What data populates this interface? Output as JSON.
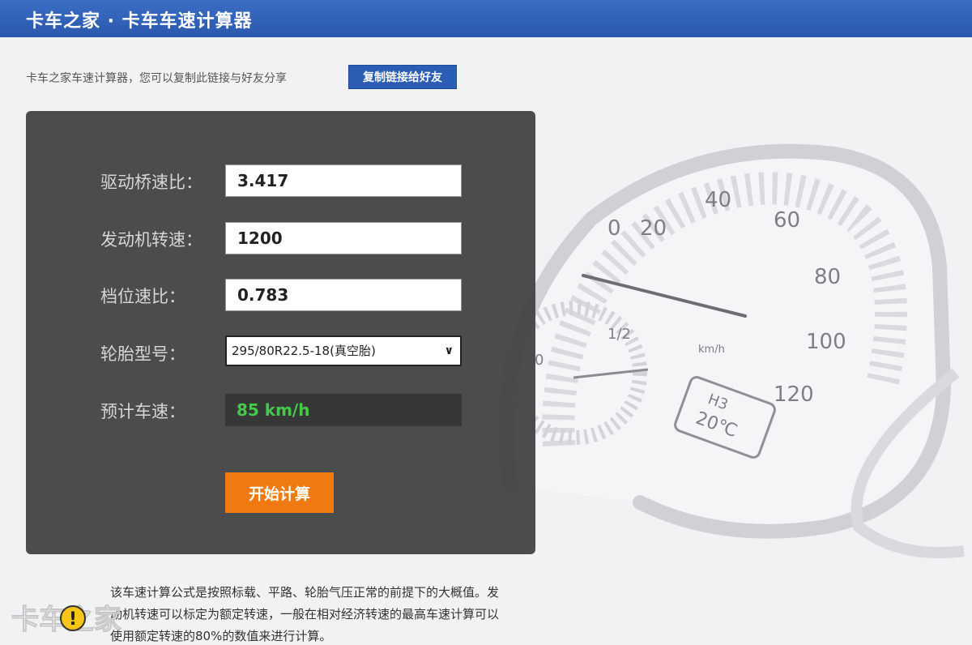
{
  "header": {
    "title": "卡车之家 · 卡车车速计算器"
  },
  "share": {
    "text": "卡车之家车速计算器，您可以复制此链接与好友分享",
    "button_label": "复制链接给好友"
  },
  "form": {
    "axle_ratio": {
      "label": "驱动桥速比：",
      "value": "3.417"
    },
    "engine_speed": {
      "label": "发动机转速：",
      "value": "1200"
    },
    "gear_ratio": {
      "label": "档位速比：",
      "value": "0.783"
    },
    "tire_model": {
      "label": "轮胎型号：",
      "selected": "295/80R22.5-18(真空胎)"
    },
    "estimated_speed": {
      "label": "预计车速：",
      "value": "85 km/h"
    },
    "calculate_button": "开始计算"
  },
  "note": {
    "text": "该车速计算公式是按照标载、平路、轮胎气压正常的前提下的大概值。发动机转速可以标定为额定转速，一般在相对经济转速的最高车速计算可以使用额定转速的80%的数值来进行计算。"
  },
  "gauge": {
    "speed_ticks": [
      "0",
      "20",
      "40",
      "60",
      "80",
      "100",
      "120"
    ],
    "unit": "km/h",
    "fuel_mark": "1/2",
    "fuel_zero": "0",
    "display": {
      "line1": "H3",
      "line2": "20℃"
    }
  },
  "watermark": {
    "text": "卡车之家"
  },
  "colors": {
    "header": "#2d5fb3",
    "panel": "#434546",
    "accent_button": "#f07a12",
    "result_text": "#46c84d",
    "share_button": "#2b5db5"
  }
}
